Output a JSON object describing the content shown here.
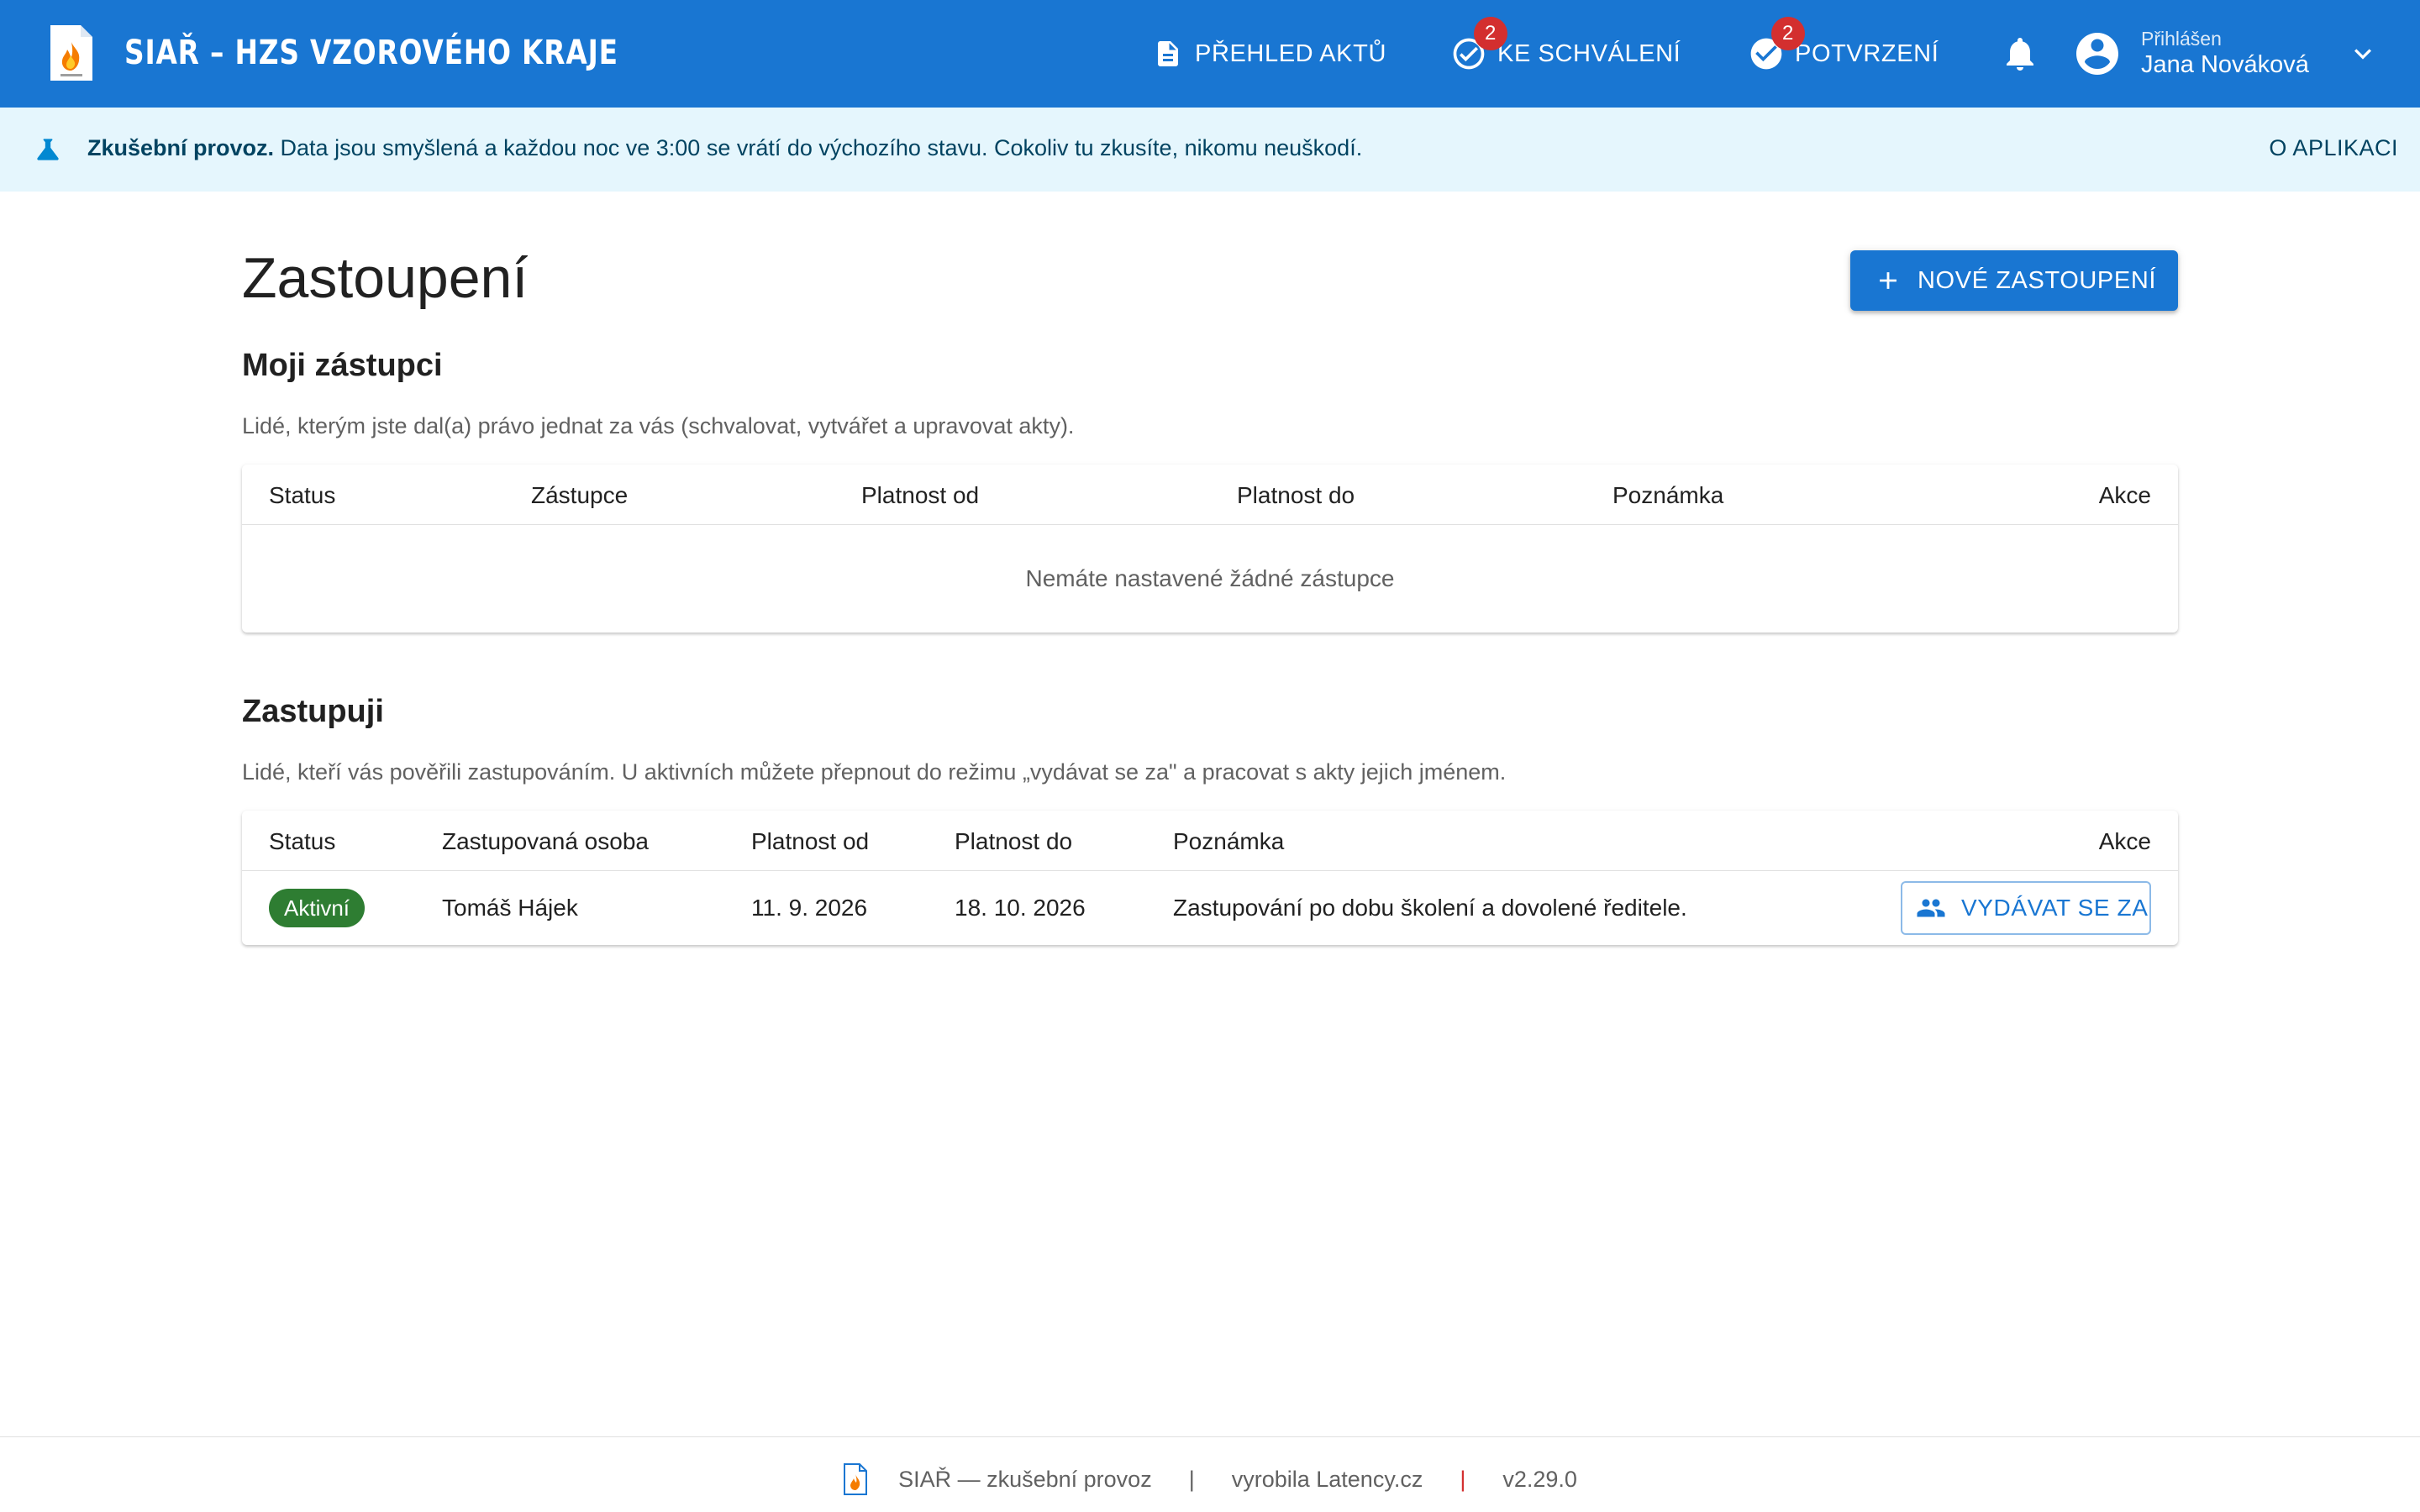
{
  "app": {
    "title": "SIAŘ – HZS VZOROVÉHO KRAJE",
    "logo_icon": "document-flame-logo"
  },
  "nav": {
    "overview": {
      "label": "PŘEHLED AKTŮ",
      "icon": "document-icon"
    },
    "approval": {
      "label": "KE SCHVÁLENÍ",
      "icon": "check-circle-outline-icon",
      "badge": "2"
    },
    "confirm": {
      "label": "POTVRZENÍ",
      "icon": "check-circle-icon",
      "badge": "2"
    },
    "notifications_icon": "bell-icon"
  },
  "user": {
    "logged_in_label": "Přihlášen",
    "name": "Jana Nováková",
    "icon": "account-circle-icon"
  },
  "banner": {
    "bold": "Zkušební provoz.",
    "text": " Data jsou smyšlená a každou noc ve 3:00 se vrátí do výchozího stavu. Cokoliv tu zkusíte, nikomu neuškodí.",
    "link": "O APLIKACI",
    "icon": "flask-icon"
  },
  "page": {
    "title": "Zastoupení",
    "new_button": "NOVÉ ZASTOUPENÍ"
  },
  "my_deputies": {
    "title": "Moji zástupci",
    "description": "Lidé, kterým jste dal(a) právo jednat za vás (schvalovat, vytvářet a upravovat akty).",
    "columns": [
      "Status",
      "Zástupce",
      "Platnost od",
      "Platnost do",
      "Poznámka",
      "Akce"
    ],
    "empty": "Nemáte nastavené žádné zástupce"
  },
  "representing": {
    "title": "Zastupuji",
    "description": "Lidé, kteří vás pověřili zastupováním. U aktivních můžete přepnout do režimu „vydávat se za\" a pracovat s akty jejich jménem.",
    "columns": [
      "Status",
      "Zastupovaná osoba",
      "Platnost od",
      "Platnost do",
      "Poznámka",
      "Akce"
    ],
    "rows": [
      {
        "status": "Aktivní",
        "person": "Tomáš Hájek",
        "from": "11. 9. 2026",
        "to": "18. 10. 2026",
        "note": "Zastupování po dobu školení a dovolené ředitele.",
        "action": "VYDÁVAT SE ZA"
      }
    ]
  },
  "footer": {
    "app": "SIAŘ — zkušební provoz",
    "maker": "vyrobila Latency.cz",
    "version": "v2.29.0",
    "sep": "|"
  },
  "colors": {
    "primary": "#1976d2",
    "banner_bg": "#e5f6fd",
    "banner_text": "#014361",
    "badge": "#d32f2f",
    "active_chip": "#2e7d32"
  }
}
